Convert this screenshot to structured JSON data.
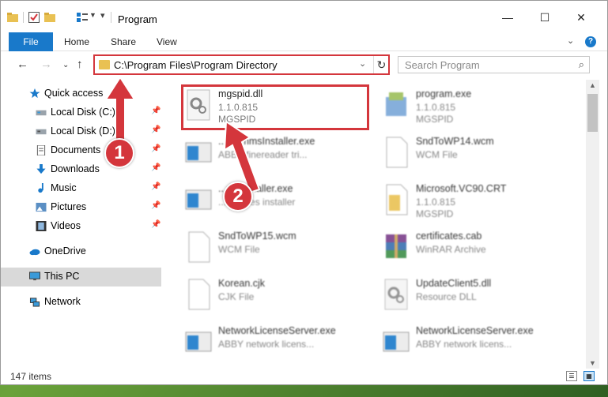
{
  "window": {
    "title": "Program"
  },
  "ribbon": {
    "file_tab": "File",
    "tabs": [
      "Home",
      "Share",
      "View"
    ]
  },
  "address": {
    "path": "C:\\Program Files\\Program Directory"
  },
  "search": {
    "placeholder": "Search Program"
  },
  "sidebar": {
    "items": [
      {
        "label": "Quick access",
        "icon": "star-icon"
      },
      {
        "label": "Local Disk (C:)",
        "icon": "drive-icon",
        "pinned": true
      },
      {
        "label": "Local Disk (D:)",
        "icon": "drive-icon",
        "pinned": true
      },
      {
        "label": "Documents",
        "icon": "documents-icon",
        "pinned": true
      },
      {
        "label": "Downloads",
        "icon": "download-arrow-icon",
        "pinned": true
      },
      {
        "label": "Music",
        "icon": "music-note-icon",
        "pinned": true
      },
      {
        "label": "Pictures",
        "icon": "pictures-icon",
        "pinned": true
      },
      {
        "label": "Videos",
        "icon": "video-film-icon",
        "pinned": true
      },
      {
        "label": "OneDrive",
        "icon": "cloud-icon"
      },
      {
        "label": "This PC",
        "icon": "monitor-icon",
        "selected": true
      },
      {
        "label": "Network",
        "icon": "network-icon"
      }
    ]
  },
  "files": [
    {
      "name": "mgspid.dll",
      "line2": "1.1.0.815",
      "line3": "MGSPID",
      "icon": "dll-gear-icon"
    },
    {
      "name": "program.exe",
      "line2": "1.1.0.815",
      "line3": "MGSPID",
      "icon": "installer-exe-icon"
    },
    {
      "name": "...grammsInstaller.exe",
      "line2": "ABBY finereader tri...",
      "line3": "",
      "icon": "exe-window-icon"
    },
    {
      "name": "SndToWP14.wcm",
      "line2": "WCM File",
      "line3": "",
      "icon": "blank-file-icon"
    },
    {
      "name": "...ateInstaller.exe",
      "line2": "...updates installer",
      "line3": "",
      "icon": "exe-window-icon"
    },
    {
      "name": "Microsoft.VC90.CRT",
      "line2": "1.1.0.815",
      "line3": "MGSPID",
      "icon": "folder-file-icon"
    },
    {
      "name": "SndToWP15.wcm",
      "line2": "WCM File",
      "line3": "",
      "icon": "blank-file-icon"
    },
    {
      "name": "certificates.cab",
      "line2": "WinRAR Archive",
      "line3": "",
      "icon": "winrar-archive-icon"
    },
    {
      "name": "Korean.cjk",
      "line2": "CJK File",
      "line3": "",
      "icon": "blank-file-icon"
    },
    {
      "name": "UpdateClient5.dll",
      "line2": "Resource DLL",
      "line3": "",
      "icon": "dll-gear-icon"
    },
    {
      "name": "NetworkLicenseServer.exe",
      "line2": "ABBY network licens...",
      "line3": "",
      "icon": "exe-window-icon"
    },
    {
      "name": "NetworkLicenseServer.exe",
      "line2": "ABBY network licens...",
      "line3": "",
      "icon": "exe-window-icon"
    }
  ],
  "status": {
    "item_count": "147 items"
  },
  "annotations": {
    "badge1": "1",
    "badge2": "2"
  },
  "colors": {
    "accent": "#1979ca",
    "highlight": "#d4363c",
    "folder": "#e9c153"
  }
}
